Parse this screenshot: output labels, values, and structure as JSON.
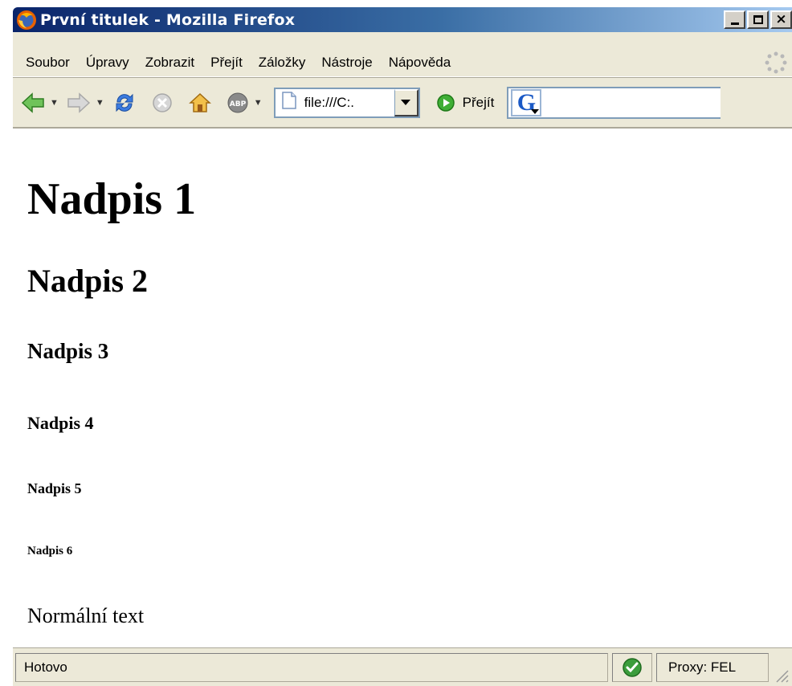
{
  "window": {
    "title": "První titulek - Mozilla Firefox",
    "title_bg_color": "#0a246a"
  },
  "menu": {
    "items": [
      "Soubor",
      "Úpravy",
      "Zobrazit",
      "Přejít",
      "Záložky",
      "Nástroje",
      "Nápověda"
    ]
  },
  "toolbar": {
    "back_icon": "back-arrow-icon",
    "forward_icon": "forward-arrow-icon",
    "reload_icon": "reload-icon",
    "stop_icon": "stop-icon",
    "home_icon": "home-icon",
    "adblock_icon": "adblock-icon",
    "address_value": "file:///C:.",
    "go_label": "Přejít",
    "search_logo": "G",
    "search_value": ""
  },
  "content": {
    "h1": "Nadpis 1",
    "h2": "Nadpis 2",
    "h3": "Nadpis 3",
    "h4": "Nadpis 4",
    "h5": "Nadpis 5",
    "h6": "Nadpis 6",
    "paragraph": "Normální text"
  },
  "status": {
    "text": "Hotovo",
    "proxy": "Proxy: FEL",
    "check_color": "#3c9d3c"
  }
}
